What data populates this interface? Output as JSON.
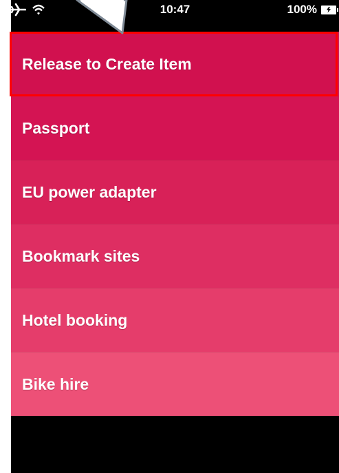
{
  "status_bar": {
    "time": "10:47",
    "battery": "100%",
    "icons": [
      "airplane-icon",
      "wifi-icon",
      "battery-icon"
    ]
  },
  "list": {
    "pull_prompt": "Release to Create Item",
    "items": [
      {
        "label": "Passport"
      },
      {
        "label": "EU power adapter"
      },
      {
        "label": "Bookmark sites"
      },
      {
        "label": "Hotel booking"
      },
      {
        "label": "Bike hire"
      }
    ]
  },
  "colors": {
    "highlight_border": "#ff0000",
    "row_0": "#d1114f",
    "row_5": "#ed5077",
    "background": "#000000"
  }
}
